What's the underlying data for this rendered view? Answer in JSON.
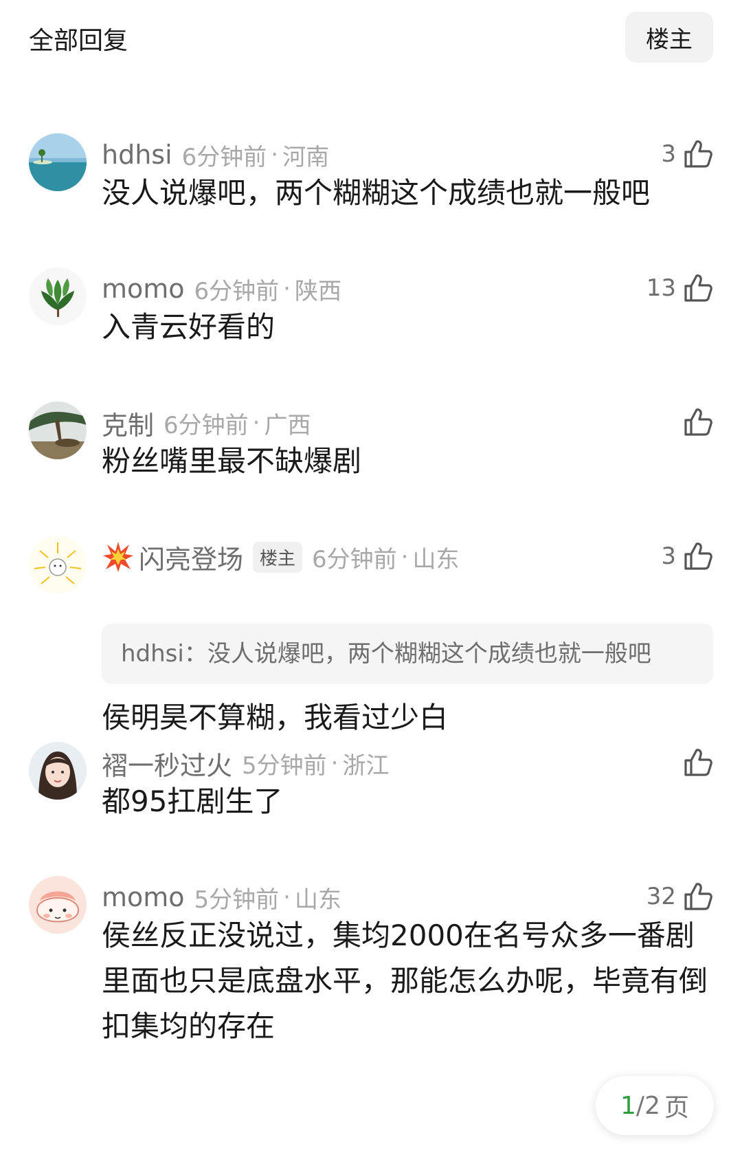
{
  "header": {
    "title": "全部回复",
    "op_filter_label": "楼主"
  },
  "comments": [
    {
      "username": "hdhsi",
      "time": "6分钟前",
      "region": "河南",
      "likes": "3",
      "text": "没人说爆吧，两个糊糊这个成绩也就一般吧"
    },
    {
      "username": "momo",
      "time": "6分钟前",
      "region": "陕西",
      "likes": "13",
      "text": "入青云好看的"
    },
    {
      "username": "克制",
      "time": "6分钟前",
      "region": "广西",
      "likes": "",
      "text": "粉丝嘴里最不缺爆剧"
    },
    {
      "username": "闪亮登场",
      "op_badge": "楼主",
      "time": "6分钟前",
      "region": "山东",
      "likes": "3",
      "quote": "hdhsi：没人说爆吧，两个糊糊这个成绩也就一般吧",
      "text": "侯明昊不算糊，我看过少白"
    },
    {
      "username": "褶一秒过火",
      "time": "5分钟前",
      "region": "浙江",
      "likes": "",
      "text": "都95扛剧生了"
    },
    {
      "username": "momo",
      "time": "5分钟前",
      "region": "山东",
      "likes": "32",
      "text": "侯丝反正没说过，集均2000在名号众多一番剧里面也只是底盘水平，那能怎么办呢，毕竟有倒扣集均的存在"
    }
  ],
  "pager": {
    "current": "1",
    "separator": "/",
    "total": "2",
    "unit": "页"
  },
  "colors": {
    "accent": "#2e9e3f",
    "meta_gray": "#a8a8a8",
    "name_gray": "#6e6e6e"
  },
  "icons": {
    "like": "thumbs-up-icon",
    "burst": "collision-emoji-icon"
  }
}
